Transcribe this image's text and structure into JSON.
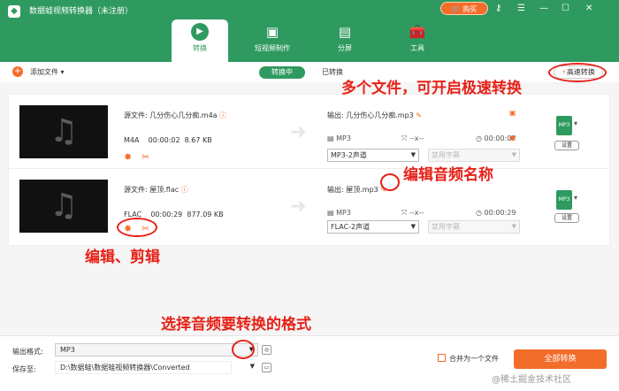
{
  "window": {
    "title": "数据蛙视频转换器（未注册）",
    "buy_label": "购买",
    "controls": [
      "key-icon",
      "menu-icon",
      "minimize-icon",
      "maximize-icon",
      "close-icon"
    ]
  },
  "nav": {
    "tabs": [
      {
        "label": "转换",
        "icon": "convert-icon"
      },
      {
        "label": "短视频制作",
        "icon": "video-edit-icon"
      },
      {
        "label": "分屏",
        "icon": "split-screen-icon"
      },
      {
        "label": "工具",
        "icon": "toolbox-icon"
      }
    ]
  },
  "toolbar": {
    "add_file": "添加文件",
    "tab_converting": "转换中",
    "tab_converted": "已转换",
    "fast_convert": "高速转换"
  },
  "files": [
    {
      "src_label": "源文件: 几分伤心几分痴.m4a",
      "format": "M4A",
      "duration": "00:00:02",
      "size": "8.67 KB",
      "output_label": "输出: 几分伤心几分痴.mp3",
      "out_format": "MP3",
      "out_res": "--x--",
      "out_duration": "00:00:02",
      "channel": "MP3-2声道",
      "subtitle": "禁用字幕",
      "out_icon": "MP3",
      "settings": "设置"
    },
    {
      "src_label": "源文件: 屋顶.flac",
      "format": "FLAC",
      "duration": "00:00:29",
      "size": "877.09 KB",
      "output_label": "输出: 屋顶.mp3",
      "out_format": "MP3",
      "out_res": "--x--",
      "out_duration": "00:00:29",
      "channel": "FLAC-2声道",
      "subtitle": "禁用字幕",
      "out_icon": "MP3",
      "settings": "设置"
    }
  ],
  "bottom": {
    "output_format_label": "输出格式:",
    "output_format": "MP3",
    "save_to_label": "保存至:",
    "save_path": "D:\\数据蛙\\数据蛙视频转换器\\Converted",
    "merge_label": "合并为一个文件",
    "convert_all": "全部转换"
  },
  "annotations": {
    "fast": "多个文件，可开启极速转换",
    "rename": "编辑音频名称",
    "edit_cut": "编辑、剪辑",
    "format": "选择音频要转换的格式"
  },
  "watermark": "@稀土掘金技术社区",
  "colors": {
    "brand": "#2e9a5f",
    "accent": "#f36d2a",
    "annotation": "#e62117"
  }
}
